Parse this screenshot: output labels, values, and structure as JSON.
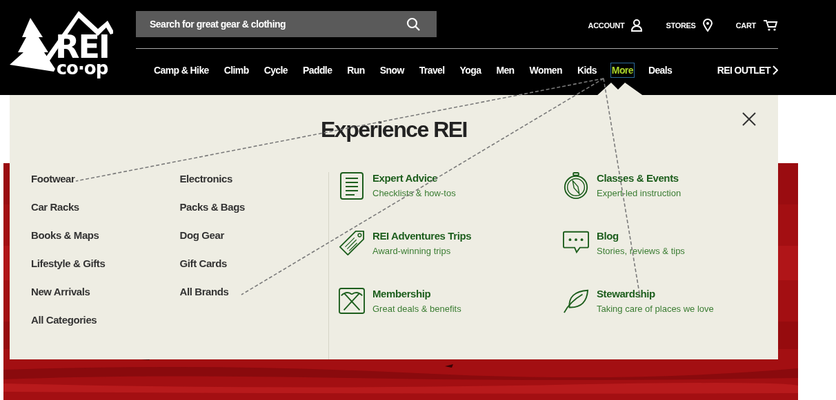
{
  "logo": {
    "wordmark": "REI",
    "subtitle": "co·op"
  },
  "search": {
    "placeholder": "Search for great gear & clothing"
  },
  "utility_links": [
    {
      "label": "ACCOUNT",
      "kind": "account"
    },
    {
      "label": "STORES",
      "kind": "stores"
    },
    {
      "label": "CART",
      "kind": "cart"
    }
  ],
  "nav": [
    {
      "label": "Camp & Hike",
      "selected": false
    },
    {
      "label": "Climb",
      "selected": false
    },
    {
      "label": "Cycle",
      "selected": false
    },
    {
      "label": "Paddle",
      "selected": false
    },
    {
      "label": "Run",
      "selected": false
    },
    {
      "label": "Snow",
      "selected": false
    },
    {
      "label": "Travel",
      "selected": false
    },
    {
      "label": "Yoga",
      "selected": false
    },
    {
      "label": "Men",
      "selected": false
    },
    {
      "label": "Women",
      "selected": false
    },
    {
      "label": "Kids",
      "selected": false
    },
    {
      "label": "More",
      "selected": true
    },
    {
      "label": "Deals",
      "selected": false
    }
  ],
  "outlet_link": "REI OUTLET",
  "menu": {
    "title": "Experience REI",
    "shop_columns": [
      [
        "Footwear",
        "Car Racks",
        "Books & Maps",
        "Lifestyle & Gifts",
        "New Arrivals",
        "All Categories"
      ],
      [
        "Electronics",
        "Packs & Bags",
        "Dog Gear",
        "Gift Cards",
        "All Brands"
      ]
    ],
    "features": [
      {
        "title": "Expert Advice",
        "subtitle": "Checklists & how-tos",
        "kind": "document"
      },
      {
        "title": "Classes & Events",
        "subtitle": "Expert-led instruction",
        "kind": "compass"
      },
      {
        "title": "REI Adventures Trips",
        "subtitle": "Award-winning trips",
        "kind": "tag"
      },
      {
        "title": "Blog",
        "subtitle": "Stories, reviews & tips",
        "kind": "chat"
      },
      {
        "title": "Membership",
        "subtitle": "Great deals & benefits",
        "kind": "pickaxes"
      },
      {
        "title": "Stewardship",
        "subtitle": "Taking care of places we love",
        "kind": "leaf"
      }
    ]
  }
}
